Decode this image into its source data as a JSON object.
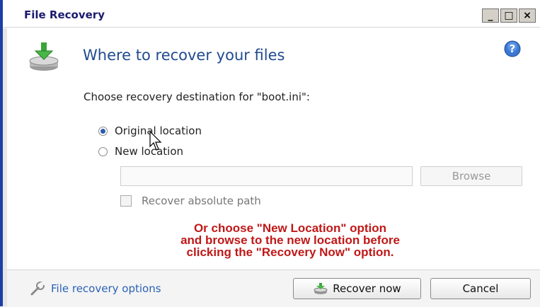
{
  "window": {
    "title": "File Recovery",
    "buttons": [
      "_",
      "□",
      "×"
    ]
  },
  "header": {
    "title": "Where to recover your files",
    "icon": "download-to-disk-icon",
    "help_icon": "help-icon"
  },
  "prompt": "Choose recovery destination for \"boot.ini\":",
  "options": {
    "original": {
      "label": "Original location",
      "selected": true
    },
    "new": {
      "label": "New location",
      "selected": false
    }
  },
  "path_input": {
    "value": ""
  },
  "browse_label": "Browse",
  "absolute_path": {
    "label": "Recover absolute path",
    "checked": false
  },
  "annotation": {
    "line1": "Or choose \"New Location\" option",
    "line2": "and browse to the new location before",
    "line3": "clicking the \"Recovery Now\" option."
  },
  "footer": {
    "options_link": "File recovery options",
    "recover_label": "Recover now",
    "cancel_label": "Cancel"
  },
  "colors": {
    "title": "#1f4a8f",
    "annotation": "#c01818",
    "link": "#2a62b8"
  }
}
